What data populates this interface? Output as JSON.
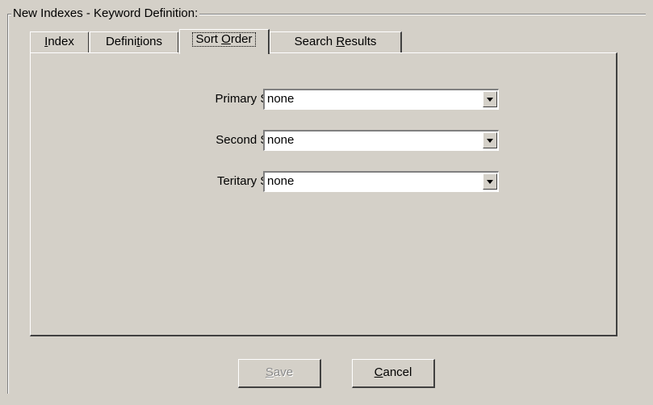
{
  "groupbox": {
    "title": "New  Indexes - Keyword Definition:"
  },
  "tabs": [
    {
      "pre": "",
      "accel": "I",
      "post": "ndex",
      "active": false
    },
    {
      "pre": "Defini",
      "accel": "t",
      "post": "ions",
      "active": false
    },
    {
      "pre": "Sort ",
      "accel": "O",
      "post": "rder",
      "active": true
    },
    {
      "pre": "Search ",
      "accel": "R",
      "post": "esults",
      "active": false
    }
  ],
  "sort": {
    "primary": {
      "label": "Primary Sort:",
      "value": "none"
    },
    "second": {
      "label": "Second Sort:",
      "value": "none"
    },
    "tertiary": {
      "label": "Teritary Sort:",
      "value": "none"
    }
  },
  "buttons": {
    "save": {
      "accel": "S",
      "rest": "ave",
      "enabled": false
    },
    "cancel": {
      "accel": "C",
      "rest": "ancel",
      "enabled": true
    }
  },
  "icons": {
    "dropdown": "chevron-down-icon"
  },
  "colors": {
    "face": "#d4d0c8",
    "disabled_text": "#8a8a8a"
  }
}
